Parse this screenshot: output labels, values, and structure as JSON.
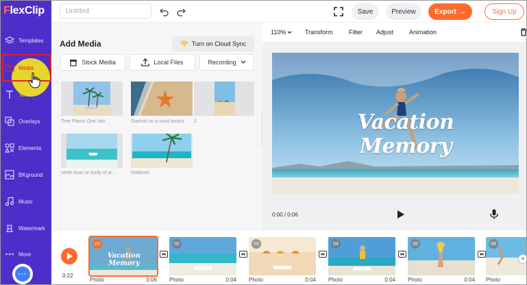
{
  "app": {
    "logo": "FlexClip",
    "logo_first": "F",
    "logo_rest": "lexClip"
  },
  "sidebar": {
    "items": [
      {
        "label": "Templates",
        "icon": "layers-icon"
      },
      {
        "label": "Media",
        "icon": "folder-media-icon",
        "active": true
      },
      {
        "label": "Text",
        "icon": "text-icon"
      },
      {
        "label": "Overlays",
        "icon": "overlays-icon"
      },
      {
        "label": "Elements",
        "icon": "elements-icon"
      },
      {
        "label": "BKground",
        "icon": "background-icon"
      },
      {
        "label": "Music",
        "icon": "music-icon"
      },
      {
        "label": "Watermark",
        "icon": "watermark-icon"
      },
      {
        "label": "More",
        "icon": "more-dots-icon"
      }
    ],
    "chat_icon": "chat-icon"
  },
  "topbar": {
    "title_placeholder": "Untitled",
    "save": "Save",
    "preview": "Preview",
    "export": "Export",
    "export_arrow": "→",
    "signup": "Sign Up"
  },
  "media_panel": {
    "title": "Add Media",
    "cloud_sync": "Turn on Cloud Sync",
    "tabs": {
      "stock": "Stock Media",
      "local": "Local Files",
      "recording": "Recording"
    },
    "thumbs": [
      {
        "caption": "Tree Plams One Van"
      },
      {
        "caption": "Starfish on a sand beach"
      },
      {
        "caption": "2"
      },
      {
        "caption": "white boat on body of w..."
      },
      {
        "caption": "Maldives"
      }
    ]
  },
  "editor_toolbar": {
    "zoom": "110%",
    "transform": "Transform",
    "filter": "Filter",
    "adjust": "Adjust",
    "animation": "Animation"
  },
  "preview": {
    "overlay_text": "Vacation Memory",
    "time": "0:00 / 0:06"
  },
  "timeline": {
    "current_time": "0:22",
    "clips": [
      {
        "num": "01",
        "type": "Photo",
        "duration": "0:06",
        "text": "Vacation Memory"
      },
      {
        "num": "02",
        "type": "Photo",
        "duration": "0:04"
      },
      {
        "num": "03",
        "type": "Photo",
        "duration": "0:04"
      },
      {
        "num": "04",
        "type": "Photo",
        "duration": "0:04"
      },
      {
        "num": "05",
        "type": "Photo",
        "duration": "0:04"
      },
      {
        "num": "06",
        "type": "Photo",
        "duration": ""
      }
    ]
  },
  "colors": {
    "sidebar": "#4d2ec8",
    "accent": "#fc6b2d"
  }
}
